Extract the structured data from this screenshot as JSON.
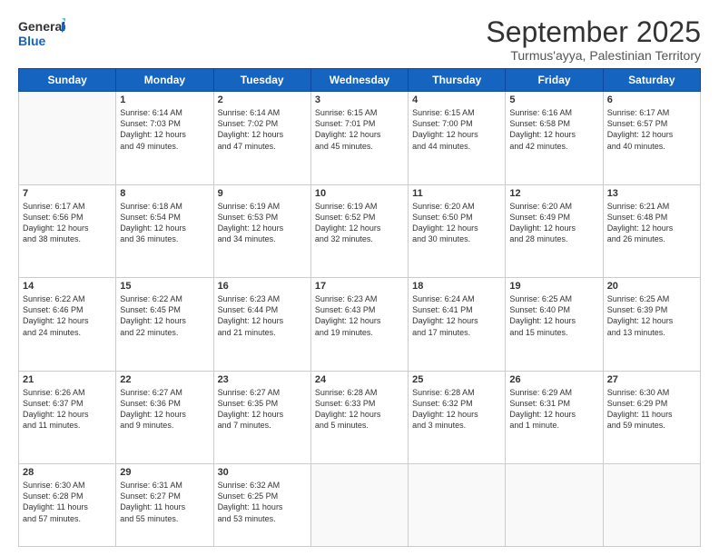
{
  "logo": {
    "general": "General",
    "blue": "Blue"
  },
  "header": {
    "title": "September 2025",
    "subtitle": "Turmus'ayya, Palestinian Territory"
  },
  "weekdays": [
    "Sunday",
    "Monday",
    "Tuesday",
    "Wednesday",
    "Thursday",
    "Friday",
    "Saturday"
  ],
  "weeks": [
    [
      {
        "day": "",
        "content": ""
      },
      {
        "day": "1",
        "content": "Sunrise: 6:14 AM\nSunset: 7:03 PM\nDaylight: 12 hours\nand 49 minutes."
      },
      {
        "day": "2",
        "content": "Sunrise: 6:14 AM\nSunset: 7:02 PM\nDaylight: 12 hours\nand 47 minutes."
      },
      {
        "day": "3",
        "content": "Sunrise: 6:15 AM\nSunset: 7:01 PM\nDaylight: 12 hours\nand 45 minutes."
      },
      {
        "day": "4",
        "content": "Sunrise: 6:15 AM\nSunset: 7:00 PM\nDaylight: 12 hours\nand 44 minutes."
      },
      {
        "day": "5",
        "content": "Sunrise: 6:16 AM\nSunset: 6:58 PM\nDaylight: 12 hours\nand 42 minutes."
      },
      {
        "day": "6",
        "content": "Sunrise: 6:17 AM\nSunset: 6:57 PM\nDaylight: 12 hours\nand 40 minutes."
      }
    ],
    [
      {
        "day": "7",
        "content": "Sunrise: 6:17 AM\nSunset: 6:56 PM\nDaylight: 12 hours\nand 38 minutes."
      },
      {
        "day": "8",
        "content": "Sunrise: 6:18 AM\nSunset: 6:54 PM\nDaylight: 12 hours\nand 36 minutes."
      },
      {
        "day": "9",
        "content": "Sunrise: 6:19 AM\nSunset: 6:53 PM\nDaylight: 12 hours\nand 34 minutes."
      },
      {
        "day": "10",
        "content": "Sunrise: 6:19 AM\nSunset: 6:52 PM\nDaylight: 12 hours\nand 32 minutes."
      },
      {
        "day": "11",
        "content": "Sunrise: 6:20 AM\nSunset: 6:50 PM\nDaylight: 12 hours\nand 30 minutes."
      },
      {
        "day": "12",
        "content": "Sunrise: 6:20 AM\nSunset: 6:49 PM\nDaylight: 12 hours\nand 28 minutes."
      },
      {
        "day": "13",
        "content": "Sunrise: 6:21 AM\nSunset: 6:48 PM\nDaylight: 12 hours\nand 26 minutes."
      }
    ],
    [
      {
        "day": "14",
        "content": "Sunrise: 6:22 AM\nSunset: 6:46 PM\nDaylight: 12 hours\nand 24 minutes."
      },
      {
        "day": "15",
        "content": "Sunrise: 6:22 AM\nSunset: 6:45 PM\nDaylight: 12 hours\nand 22 minutes."
      },
      {
        "day": "16",
        "content": "Sunrise: 6:23 AM\nSunset: 6:44 PM\nDaylight: 12 hours\nand 21 minutes."
      },
      {
        "day": "17",
        "content": "Sunrise: 6:23 AM\nSunset: 6:43 PM\nDaylight: 12 hours\nand 19 minutes."
      },
      {
        "day": "18",
        "content": "Sunrise: 6:24 AM\nSunset: 6:41 PM\nDaylight: 12 hours\nand 17 minutes."
      },
      {
        "day": "19",
        "content": "Sunrise: 6:25 AM\nSunset: 6:40 PM\nDaylight: 12 hours\nand 15 minutes."
      },
      {
        "day": "20",
        "content": "Sunrise: 6:25 AM\nSunset: 6:39 PM\nDaylight: 12 hours\nand 13 minutes."
      }
    ],
    [
      {
        "day": "21",
        "content": "Sunrise: 6:26 AM\nSunset: 6:37 PM\nDaylight: 12 hours\nand 11 minutes."
      },
      {
        "day": "22",
        "content": "Sunrise: 6:27 AM\nSunset: 6:36 PM\nDaylight: 12 hours\nand 9 minutes."
      },
      {
        "day": "23",
        "content": "Sunrise: 6:27 AM\nSunset: 6:35 PM\nDaylight: 12 hours\nand 7 minutes."
      },
      {
        "day": "24",
        "content": "Sunrise: 6:28 AM\nSunset: 6:33 PM\nDaylight: 12 hours\nand 5 minutes."
      },
      {
        "day": "25",
        "content": "Sunrise: 6:28 AM\nSunset: 6:32 PM\nDaylight: 12 hours\nand 3 minutes."
      },
      {
        "day": "26",
        "content": "Sunrise: 6:29 AM\nSunset: 6:31 PM\nDaylight: 12 hours\nand 1 minute."
      },
      {
        "day": "27",
        "content": "Sunrise: 6:30 AM\nSunset: 6:29 PM\nDaylight: 11 hours\nand 59 minutes."
      }
    ],
    [
      {
        "day": "28",
        "content": "Sunrise: 6:30 AM\nSunset: 6:28 PM\nDaylight: 11 hours\nand 57 minutes."
      },
      {
        "day": "29",
        "content": "Sunrise: 6:31 AM\nSunset: 6:27 PM\nDaylight: 11 hours\nand 55 minutes."
      },
      {
        "day": "30",
        "content": "Sunrise: 6:32 AM\nSunset: 6:25 PM\nDaylight: 11 hours\nand 53 minutes."
      },
      {
        "day": "",
        "content": ""
      },
      {
        "day": "",
        "content": ""
      },
      {
        "day": "",
        "content": ""
      },
      {
        "day": "",
        "content": ""
      }
    ]
  ]
}
